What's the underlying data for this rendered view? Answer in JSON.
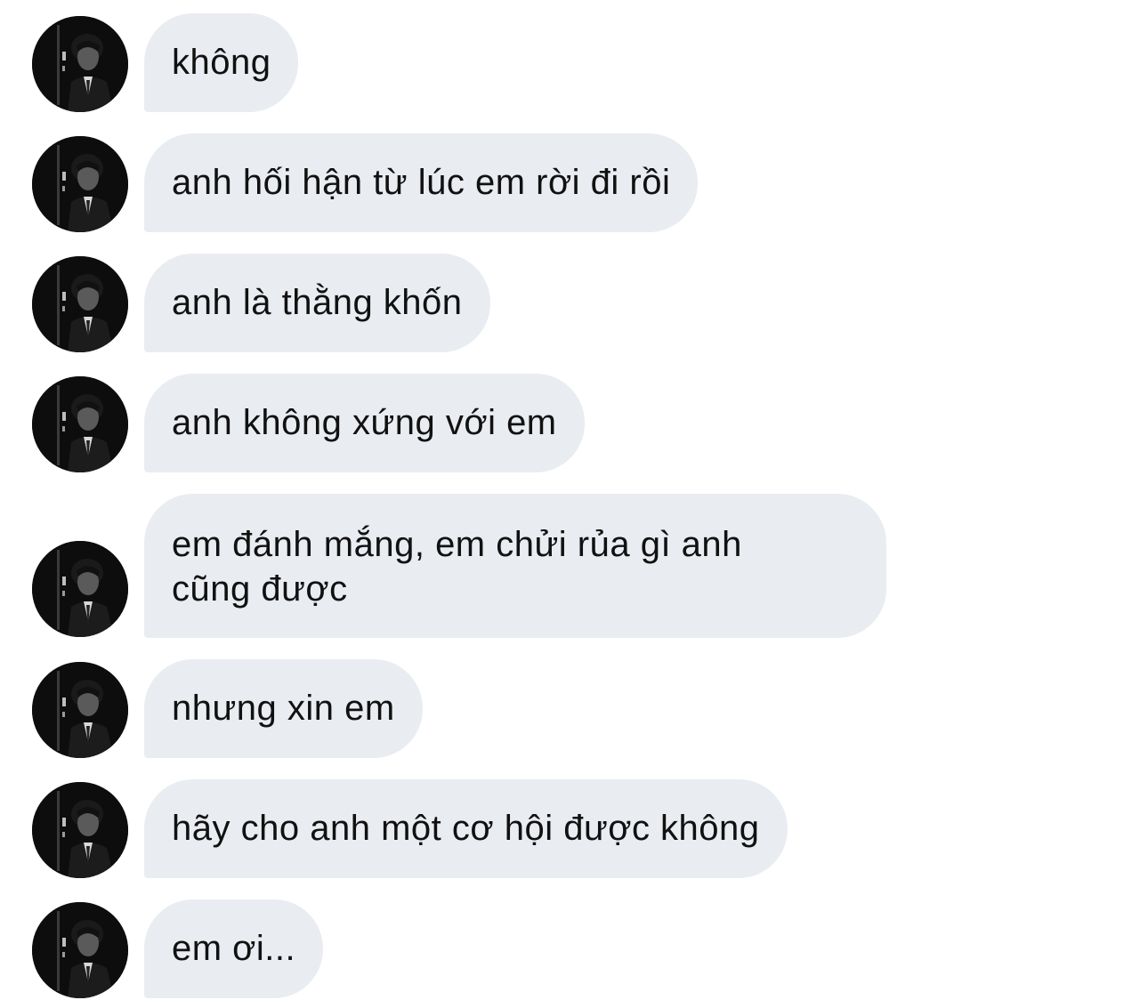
{
  "conversation": {
    "messages": [
      {
        "text": "không"
      },
      {
        "text": "anh hối hận từ lúc em rời đi rồi"
      },
      {
        "text": "anh là thằng khốn"
      },
      {
        "text": "anh không xứng với em"
      },
      {
        "line1": "em đánh mắng, em chửi rủa gì anh",
        "line2": "cũng được"
      },
      {
        "text": "nhưng xin em"
      },
      {
        "text": "hãy cho anh một cơ hội được không"
      },
      {
        "text": "em ơi..."
      }
    ]
  },
  "colors": {
    "bubble_background": "#e9ecf1",
    "text": "#111111",
    "page_background": "#ffffff"
  },
  "icons": {
    "avatar": "contact-avatar-photo"
  }
}
